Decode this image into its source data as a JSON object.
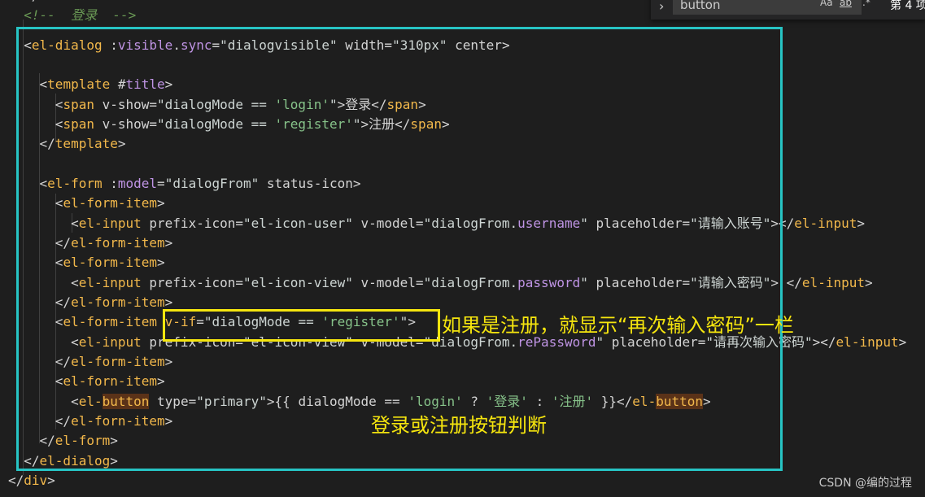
{
  "find_widget": {
    "query": "button",
    "option_case": "Aa",
    "option_word": "ab",
    "option_regex": ".*",
    "count_text": "第 4 项"
  },
  "code_lines": [
    "  </div>",
    "  <!--  登录  -->",
    "  <el-dialog :visible.sync=\"dialogvisible\" width=\"310px\" center>",
    "",
    "    <template #title>",
    "      <span v-show=\"dialogMode == 'login'\">登录</span>",
    "      <span v-show=\"dialogMode == 'register'\">注册</span>",
    "    </template>",
    "",
    "    <el-form :model=\"dialogFrom\" status-icon>",
    "      <el-form-item>",
    "        <el-input prefix-icon=\"el-icon-user\" v-model=\"dialogFrom.username\" placeholder=\"请输入账号\"></el-input>",
    "      </el-form-item>",
    "      <el-form-item>",
    "        <el-input prefix-icon=\"el-icon-view\" v-model=\"dialogFrom.password\" placeholder=\"请输入密码\"> </el-input>",
    "      </el-form-item>",
    "      <el-form-item v-if=\"dialogMode == 'register'\">",
    "        <el-input prefix-icon=\"el-icon-view\" v-model=\"dialogFrom.rePassword\" placeholder=\"请再次输入密码\"></el-input>",
    "      </el-form-item>",
    "      <el-forn-item>",
    "        <el-button type=\"primary\">{{ dialogMode == 'login' ? '登录' : '注册' }}</el-button>",
    "      </el-forn-item>",
    "    </el-form>",
    "  </el-dialog>",
    "</div>"
  ],
  "annotations": {
    "register_note": "如果是注册，就显示“再次输入密码”一栏",
    "button_note": "登录或注册按钮判断"
  },
  "watermark": "CSDN @编的过程",
  "colors": {
    "background": "#1e1e1e",
    "tag": "#f2b84b",
    "cyan_box": "#27c4c4",
    "yellow_box": "#f5e50e"
  }
}
